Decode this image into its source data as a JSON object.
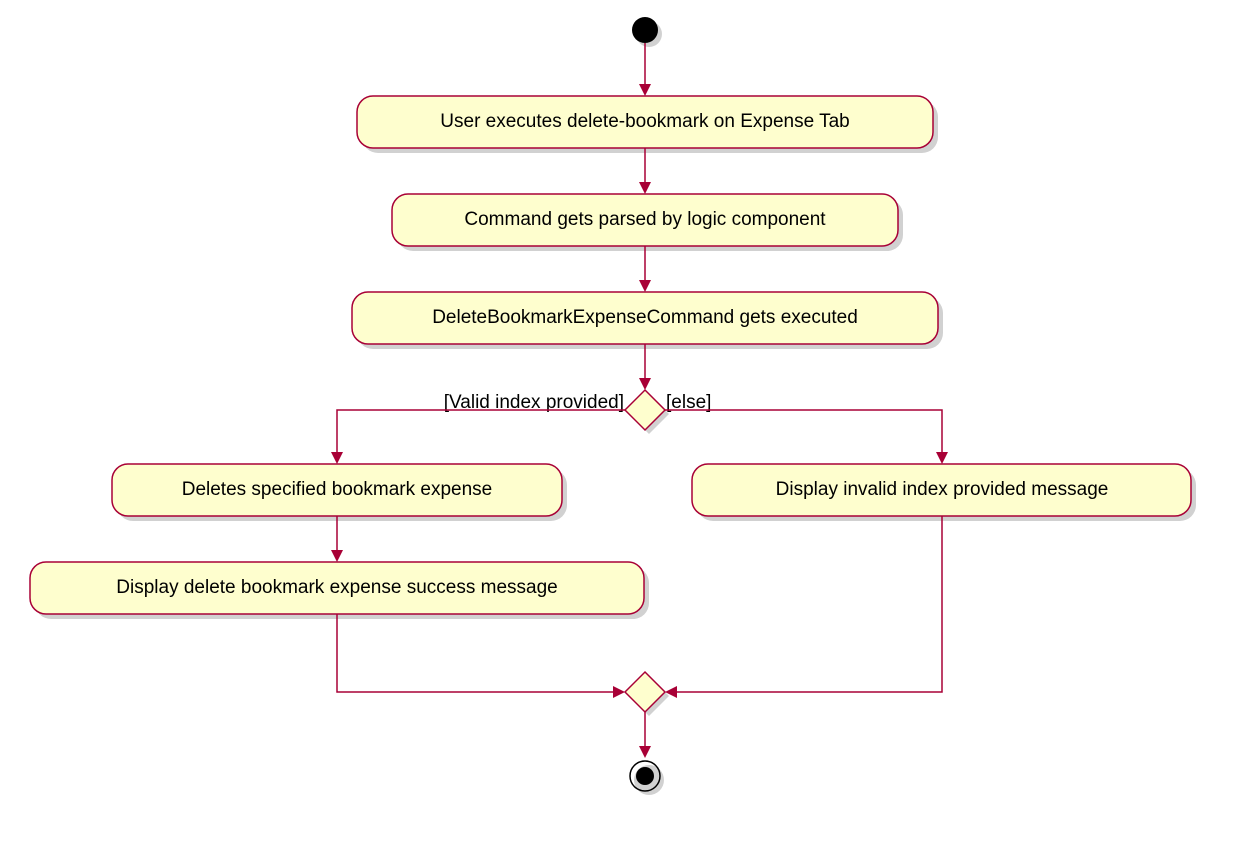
{
  "diagram": {
    "type": "uml-activity",
    "nodes": {
      "start": {
        "kind": "initial"
      },
      "a1": {
        "kind": "activity",
        "label": "User executes delete-bookmark on Expense Tab"
      },
      "a2": {
        "kind": "activity",
        "label": "Command gets parsed by logic component"
      },
      "a3": {
        "kind": "activity",
        "label": "DeleteBookmarkExpenseCommand gets executed"
      },
      "d1": {
        "kind": "decision"
      },
      "a4": {
        "kind": "activity",
        "label": "Deletes specified bookmark expense"
      },
      "a5": {
        "kind": "activity",
        "label": "Display delete bookmark expense success message"
      },
      "a6": {
        "kind": "activity",
        "label": "Display invalid index provided message"
      },
      "m1": {
        "kind": "merge"
      },
      "end": {
        "kind": "final"
      }
    },
    "guards": {
      "left": "[Valid index provided]",
      "right": "[else]"
    },
    "edges": [
      {
        "from": "start",
        "to": "a1"
      },
      {
        "from": "a1",
        "to": "a2"
      },
      {
        "from": "a2",
        "to": "a3"
      },
      {
        "from": "a3",
        "to": "d1"
      },
      {
        "from": "d1",
        "to": "a4",
        "guard": "left"
      },
      {
        "from": "d1",
        "to": "a6",
        "guard": "right"
      },
      {
        "from": "a4",
        "to": "a5"
      },
      {
        "from": "a5",
        "to": "m1"
      },
      {
        "from": "a6",
        "to": "m1"
      },
      {
        "from": "m1",
        "to": "end"
      }
    ]
  }
}
